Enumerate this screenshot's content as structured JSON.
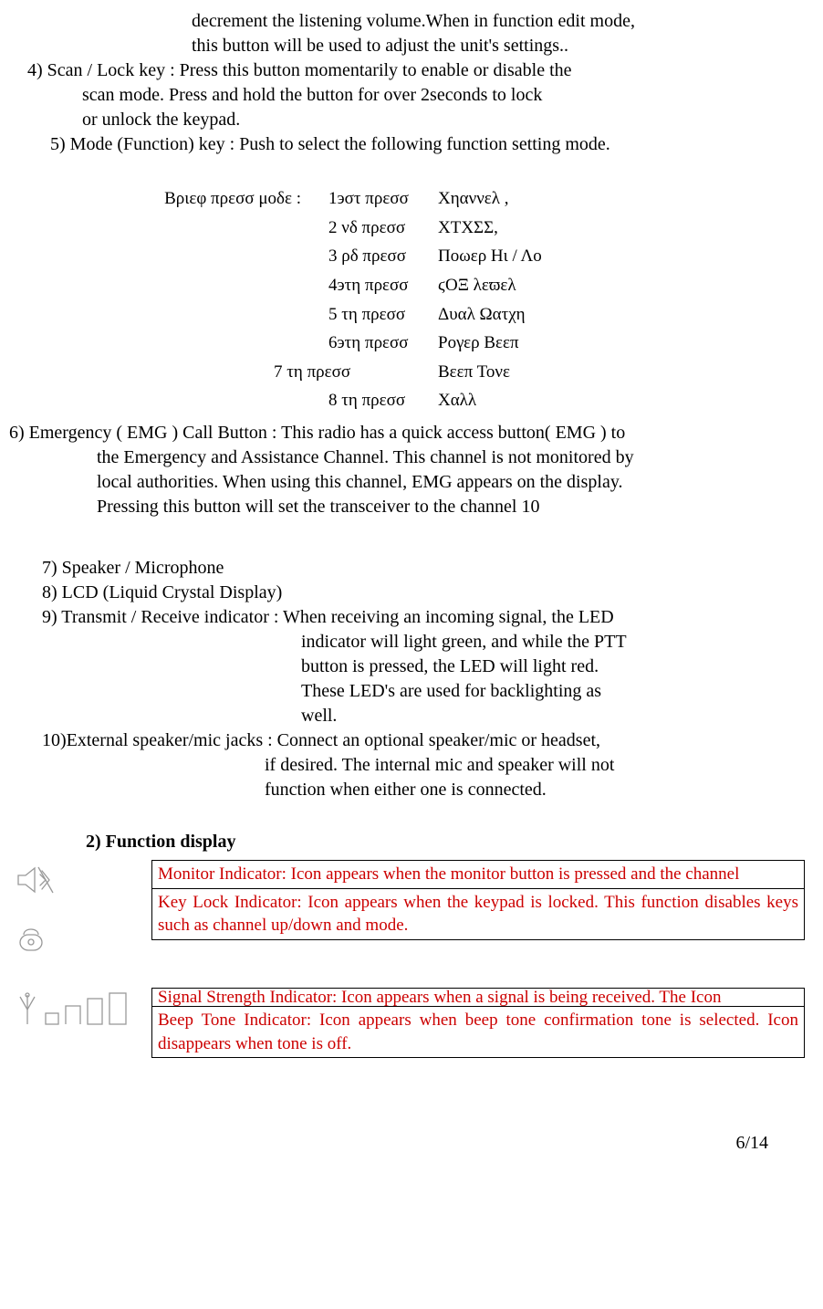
{
  "top": {
    "line1": "decrement the listening volume.When in function edit mode,",
    "line2": "this button will be used to adjust the unit's settings.."
  },
  "item4": {
    "line1": "4) Scan / Lock key : Press this button momentarily to enable or disable the",
    "line2": "scan mode. Press and hold the button for over 2seconds to lock",
    "line3": "or unlock the keypad."
  },
  "item5": {
    "line1": "5) Mode (Function) key : Push to select the following function setting mode."
  },
  "brief": {
    "label": "Βριεφ πρεσσ μοδε :",
    "rows": [
      {
        "press": "1эστ πρεσσ",
        "func": "Χηαννελ ,"
      },
      {
        "press": "2  νδ πρεσσ",
        "func": "ΧΤΧΣΣ,"
      },
      {
        "press": "3  ρδ πρεσσ",
        "func": "Ποωερ Ηι / Λο"
      },
      {
        "press": "4эτη πρεσσ",
        "func": "ϛΟΞ λεϖελ"
      },
      {
        "press": "5  τη πρεσσ",
        "func": "Δυαλ Ωατχη"
      },
      {
        "press": "6эτη πρεσσ",
        "func": "Ρογερ Βεεπ"
      },
      {
        "press": "7  τη πρεσσ",
        "func": "Βεεπ Τονε"
      },
      {
        "press": "8  τη πρεσσ",
        "func": "Χαλλ"
      }
    ]
  },
  "item6": {
    "line1": "6) Emergency ( EMG ) Call Button : This radio has a quick access button( EMG ) to",
    "line2": "the Emergency and Assistance Channel. This channel is not monitored by",
    "line3": "local authorities. When using this channel, EMG appears on the display.",
    "line4": "Pressing this button will set the transceiver to the channel 10"
  },
  "item7": {
    "line1": "7) Speaker / Microphone"
  },
  "item8": {
    "line1": "8) LCD (Liquid Crystal Display)"
  },
  "item9": {
    "line1": "9) Transmit / Receive indicator : When receiving an incoming signal, the LED",
    "line2": "indicator will light green, and while the PTT",
    "line3": "button is pressed, the LED will light red.",
    "line4": "These LED's are used for backlighting as",
    "line5": "well."
  },
  "item10": {
    "line1": "10)External speaker/mic jacks : Connect an optional speaker/mic or headset,",
    "line2": "if desired. The internal mic and speaker will not",
    "line3": "function when either one is connected."
  },
  "heading": "2) Function display",
  "func1": {
    "row1": "Monitor Indicator: Icon appears when the monitor button is pressed and the channel",
    "row2": "Key Lock Indicator: Icon appears when the keypad is locked. This function disables keys such as channel up/down and mode."
  },
  "func2": {
    "row1": "Signal Strength Indicator: Icon appears when a signal is being received. The Icon",
    "row2": "Beep Tone Indicator: Icon appears when beep tone confirmation tone is selected. Icon disappears when tone is off."
  },
  "pagenum": "6/14"
}
